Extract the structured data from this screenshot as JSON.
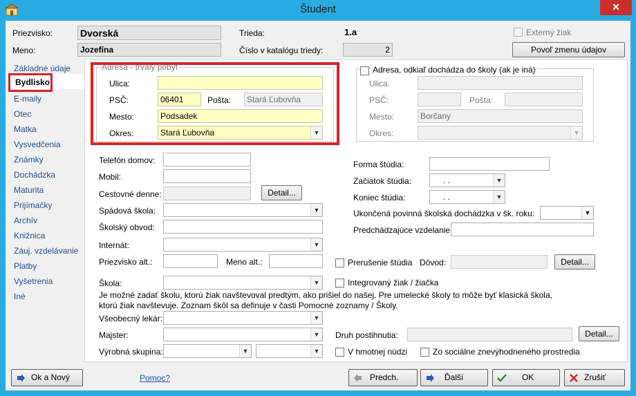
{
  "window": {
    "title": "Študent",
    "close_glyph": "✕"
  },
  "header": {
    "surname_label": "Priezvisko:",
    "surname_value": "Dvorská",
    "name_label": "Meno:",
    "name_value": "Jozefína",
    "class_label": "Trieda:",
    "class_value": "1.a",
    "catalog_label": "Číslo v katalógu triedy:",
    "catalog_value": "2",
    "external_label": "Externý žiak",
    "allow_change_button": "Povoľ zmenu údajov"
  },
  "sidebar": {
    "items": [
      "Základné údaje",
      "Bydlisko",
      "E-maily",
      "Otec",
      "Matka",
      "Vysvedčenia",
      "Známky",
      "Dochádzka",
      "Maturita",
      "Prijímačky",
      "Archív",
      "Knižnica",
      "Záuj. vzdelávanie",
      "Platby",
      "Vyšetrenia",
      "Iné"
    ],
    "active_index": 1
  },
  "permanent_address": {
    "title": "Adresa - trvalý pobyt",
    "street_label": "Ulica:",
    "street_value": "",
    "psc_label": "PSČ:",
    "psc_value": "06401",
    "post_label": "Pošta:",
    "post_value": "Stará Ľubovňa",
    "city_label": "Mesto:",
    "city_value": "Podsadek",
    "district_label": "Okres:",
    "district_value": "Stará Ľubovňa"
  },
  "commute_address": {
    "title": "Adresa, odkiaľ dochádza do školy (ak je iná)",
    "street_label": "Ulica:",
    "psc_label": "PSČ:",
    "post_label": "Pošta:",
    "city_label": "Mesto:",
    "city_value": "Borčany",
    "district_label": "Okres:"
  },
  "contact": {
    "phone_label": "Telefón domov:",
    "mobile_label": "Mobil:",
    "travel_label": "Cestovné denne:",
    "detail_button": "Detail...",
    "catchment_school_label": "Spádová škola:",
    "school_district_label": "Školský obvod:",
    "dormitory_label": "Internát:",
    "alt_surname_label": "Priezvisko alt.:",
    "alt_name_label": "Meno alt.:",
    "school_label": "Škola:",
    "school_note": "Je možné zadať školu, ktorú žiak navštevoval predtým, ako prišiel do našej. Pre umelecké školy to môže byť klasická škola, ktorú žiak navštevuje. Zoznam škôl sa definuje v časti Pomocné zoznamy / Školy.",
    "doctor_label": "Všeobecný lekár:",
    "master_label": "Majster:",
    "production_group_label": "Výrobná skupina:"
  },
  "study": {
    "form_label": "Forma štúdia:",
    "start_label": "Začiatok štúdia:",
    "start_value": ".   .",
    "end_label": "Koniec štúdia:",
    "end_value": ".   .",
    "compulsory_label": "Ukončená povinná školská dochádzka v šk. roku:",
    "previous_edu_label": "Predchádzajúce vzdelanie:",
    "interruption_label": "Prerušenie štúdia",
    "reason_label": "Dôvod:",
    "detail_button": "Detail...",
    "integrated_label": "Integrovaný žiak / žiačka",
    "disability_label": "Druh postihnutia:",
    "disability_detail_button": "Detail...",
    "need_label": "V hmotnej núdzi",
    "disadvantaged_label": "Zo sociálne znevýhodneného prostredia"
  },
  "footer": {
    "ok_new": "Ok a Nový",
    "help": "Pomoc?",
    "prev": "Predch.",
    "next": "Ďalší",
    "ok": "OK",
    "cancel": "Zrušiť"
  },
  "colors": {
    "accent_red": "#d9232a",
    "titlebar": "#29abe2",
    "link": "#1a4fb5"
  }
}
